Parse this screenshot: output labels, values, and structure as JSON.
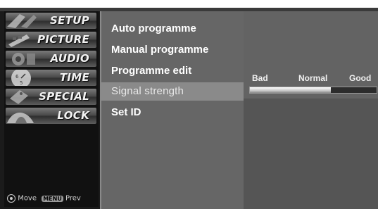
{
  "menu": {
    "items": [
      {
        "label": "SETUP"
      },
      {
        "label": "PICTURE"
      },
      {
        "label": "AUDIO"
      },
      {
        "label": "TIME"
      },
      {
        "label": "SPECIAL"
      },
      {
        "label": "LOCK"
      }
    ],
    "hint_move": "Move",
    "hint_menu_key": "MENU",
    "hint_prev": "Prev"
  },
  "submenu": {
    "items": [
      {
        "label": "Auto programme"
      },
      {
        "label": "Manual programme"
      },
      {
        "label": "Programme edit"
      },
      {
        "label": "Signal strength"
      },
      {
        "label": "Set ID"
      }
    ],
    "selected": "Signal strength"
  },
  "signal": {
    "labels": [
      "Bad",
      "Normal",
      "Good"
    ],
    "level": 0.64
  },
  "colors": {
    "osd_background": "#1b1b1b",
    "submenu_panel": "#666666",
    "selection": "#8a8a8a",
    "right_panel": "#555555"
  }
}
